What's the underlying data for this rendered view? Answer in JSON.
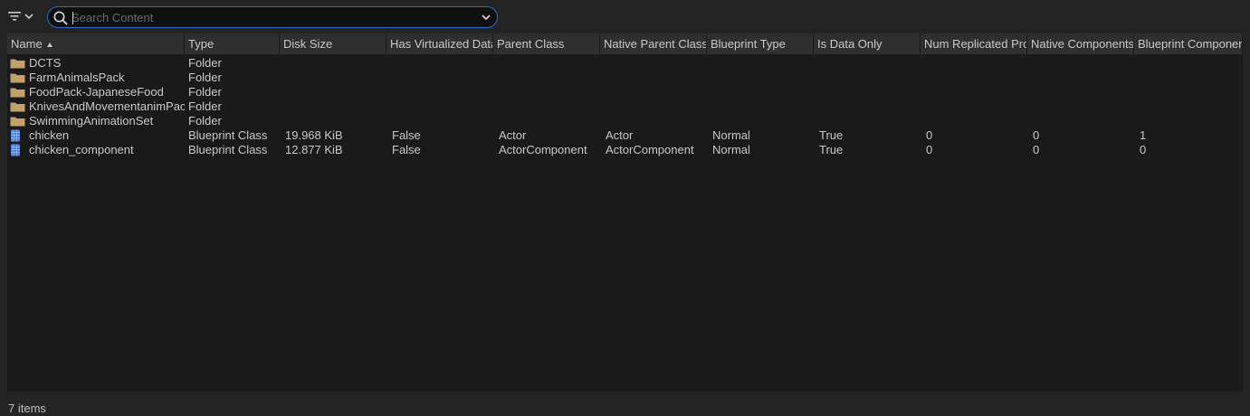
{
  "search": {
    "placeholder": "Search Content",
    "value": ""
  },
  "columns": [
    "Name",
    "Type",
    "Disk Size",
    "Has Virtualized Data",
    "Parent Class",
    "Native Parent Class",
    "Blueprint Type",
    "Is Data Only",
    "Num Replicated Pro",
    "Native Components",
    "Blueprint Componer"
  ],
  "sort": {
    "column": "Name",
    "direction": "ascending"
  },
  "rows": [
    {
      "icon": "folder-icon",
      "name": "DCTS",
      "type": "Folder",
      "disk_size": "",
      "has_virtualized_data": "",
      "parent_class": "",
      "native_parent_class": "",
      "blueprint_type": "",
      "is_data_only": "",
      "num_replicated": "",
      "native_components": "",
      "blueprint_components": ""
    },
    {
      "icon": "folder-icon",
      "name": "FarmAnimalsPack",
      "type": "Folder",
      "disk_size": "",
      "has_virtualized_data": "",
      "parent_class": "",
      "native_parent_class": "",
      "blueprint_type": "",
      "is_data_only": "",
      "num_replicated": "",
      "native_components": "",
      "blueprint_components": ""
    },
    {
      "icon": "folder-icon",
      "name": "FoodPack-JapaneseFood",
      "type": "Folder",
      "disk_size": "",
      "has_virtualized_data": "",
      "parent_class": "",
      "native_parent_class": "",
      "blueprint_type": "",
      "is_data_only": "",
      "num_replicated": "",
      "native_components": "",
      "blueprint_components": ""
    },
    {
      "icon": "folder-icon",
      "name": "KnivesAndMovementanimPack",
      "type": "Folder",
      "disk_size": "",
      "has_virtualized_data": "",
      "parent_class": "",
      "native_parent_class": "",
      "blueprint_type": "",
      "is_data_only": "",
      "num_replicated": "",
      "native_components": "",
      "blueprint_components": ""
    },
    {
      "icon": "folder-icon",
      "name": "SwimmingAnimationSet",
      "type": "Folder",
      "disk_size": "",
      "has_virtualized_data": "",
      "parent_class": "",
      "native_parent_class": "",
      "blueprint_type": "",
      "is_data_only": "",
      "num_replicated": "",
      "native_components": "",
      "blueprint_components": ""
    },
    {
      "icon": "blueprint-icon",
      "name": "chicken",
      "type": "Blueprint Class",
      "disk_size": "19.968 KiB",
      "has_virtualized_data": "False",
      "parent_class": "Actor",
      "native_parent_class": "Actor",
      "blueprint_type": "Normal",
      "is_data_only": "True",
      "num_replicated": "0",
      "native_components": "0",
      "blueprint_components": "1"
    },
    {
      "icon": "blueprint-icon",
      "name": "chicken_component",
      "type": "Blueprint Class",
      "disk_size": "12.877 KiB",
      "has_virtualized_data": "False",
      "parent_class": "ActorComponent",
      "native_parent_class": "ActorComponent",
      "blueprint_type": "Normal",
      "is_data_only": "True",
      "num_replicated": "0",
      "native_components": "0",
      "blueprint_components": "0"
    }
  ],
  "status": {
    "item_count": "7 items"
  },
  "colors": {
    "background": "#242424",
    "table_background": "#1a1a1a",
    "header_background": "#2f2f2f",
    "accent": "#2a6fc9",
    "folder": "#c4a16a",
    "blueprint": "#4a7fe0"
  }
}
